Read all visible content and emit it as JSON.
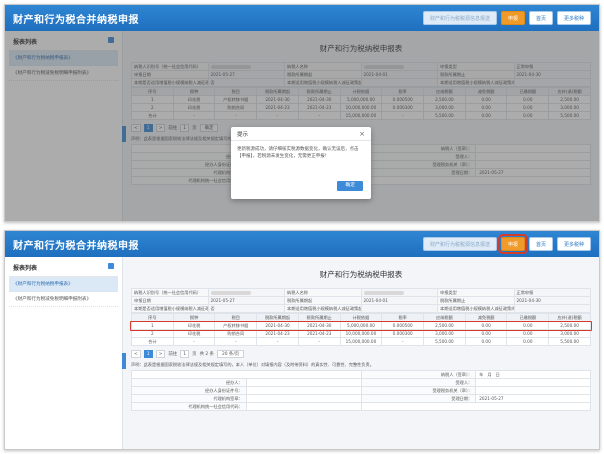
{
  "app": {
    "title": "财产和行为税合并纳税申报",
    "buttons": {
      "ghost": "财产和行为税税源信息报送",
      "apply": "申报",
      "home": "首页",
      "more": "更多税种"
    }
  },
  "sidebar": {
    "title": "报表列表",
    "items": [
      {
        "label": "《财产和行为税纳税申报表》"
      },
      {
        "label": "《财产和行为税减免税明细申报附表》"
      }
    ]
  },
  "form": {
    "title": "财产和行为税纳税申报表",
    "kv_rows": [
      [
        "纳税人识别号（统一社会信用代码）",
        "",
        "纳税人名称",
        "",
        "申报类型",
        "正常申报"
      ],
      [
        "申报日期",
        "2021-05-27",
        "税款所属期起",
        "2021-04-01",
        "税款所属期止",
        "2021-04-30"
      ],
      [
        "本期是否适用增值税小规模纳税人减征政策",
        "否",
        "本期适用增值税小规模纳税人减征政策起始时间",
        "",
        "本期适用增值税小规模纳税人减征政策终止时间",
        ""
      ]
    ],
    "table": {
      "headers": [
        "序号",
        "税种",
        "税目",
        "税款所属期起",
        "税款所属期止",
        "计税依据",
        "税率",
        "应纳税额",
        "减免税额",
        "已缴税额",
        "应补(退)税额"
      ],
      "rows": [
        [
          "1",
          "印花税",
          "产权转移书据",
          "2021-04-30",
          "2021-04-30",
          "5,000,000.00",
          "0.000500",
          "2,500.00",
          "0.00",
          "0.00",
          "2,500.00"
        ],
        [
          "2",
          "印花税",
          "购销合同",
          "2021-04-23",
          "2021-04-23",
          "10,000,000.00",
          "0.000300",
          "3,000.00",
          "0.00",
          "0.00",
          "3,000.00"
        ],
        [
          "合计",
          "-",
          "-",
          "-",
          "-",
          "15,000,000.00",
          "-",
          "5,500.00",
          "0.00",
          "0.00",
          "5,500.00"
        ]
      ]
    },
    "pager": {
      "prev": "<",
      "current": "1",
      "next": ">",
      "goto_label": "前往",
      "goto_value": "1",
      "page_unit": "页",
      "confirm": "确定",
      "total": "共 2 条",
      "page_size": "20 条/页"
    },
    "note": "声明：此表是根据国家税收法律法规及相关规定填写的，本人（单位）对填报内容（及附带资料）的真实性、可靠性、完整性负责。",
    "signature": {
      "taxpayer_sign": "纳税人（签章）：",
      "date_y": "年",
      "date_m": "月",
      "date_d": "日",
      "agent": "经办人：",
      "agent_id": "经办人身份证件号：",
      "agency_sign": "代理机构签章：",
      "agency_code": "代理机构统一社会信用代码：",
      "receiver": "受理人：",
      "receive_office": "受理税务机关（章）：",
      "receive_date": "受理日期：",
      "receive_date_val": "2021-05-27"
    }
  },
  "dialog": {
    "title": "提示",
    "message": "更新税源成功，请仔细核实税源数据变化，确认无误后，点击【申报】，若税源未发生变化，无需更正申报！",
    "ok": "确定",
    "close_icon": "×"
  }
}
